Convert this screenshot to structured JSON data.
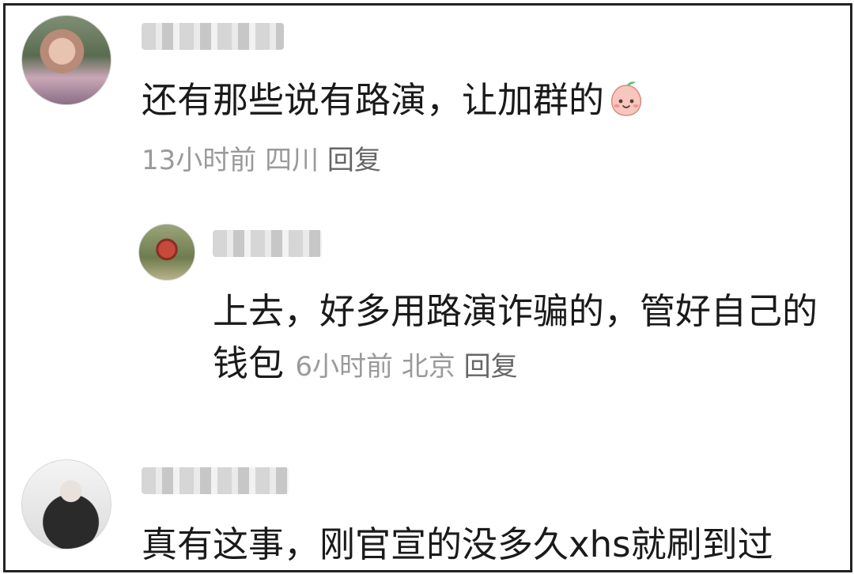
{
  "comments": [
    {
      "text": "还有那些说有路演，让加群的",
      "emoji": "peach-smile-emoji",
      "time": "13小时前",
      "location": "四川",
      "reply_label": "回复"
    },
    {
      "text": "上去，好多用路演诈骗的，管好自己的钱包",
      "time": "6小时前",
      "location": "北京",
      "reply_label": "回复"
    },
    {
      "text": "真有这事，刚官宣的没多久xhs就刷到过"
    }
  ],
  "colors": {
    "text": "#1a1a1a",
    "meta": "#9a9a9a",
    "border": "#222222"
  }
}
